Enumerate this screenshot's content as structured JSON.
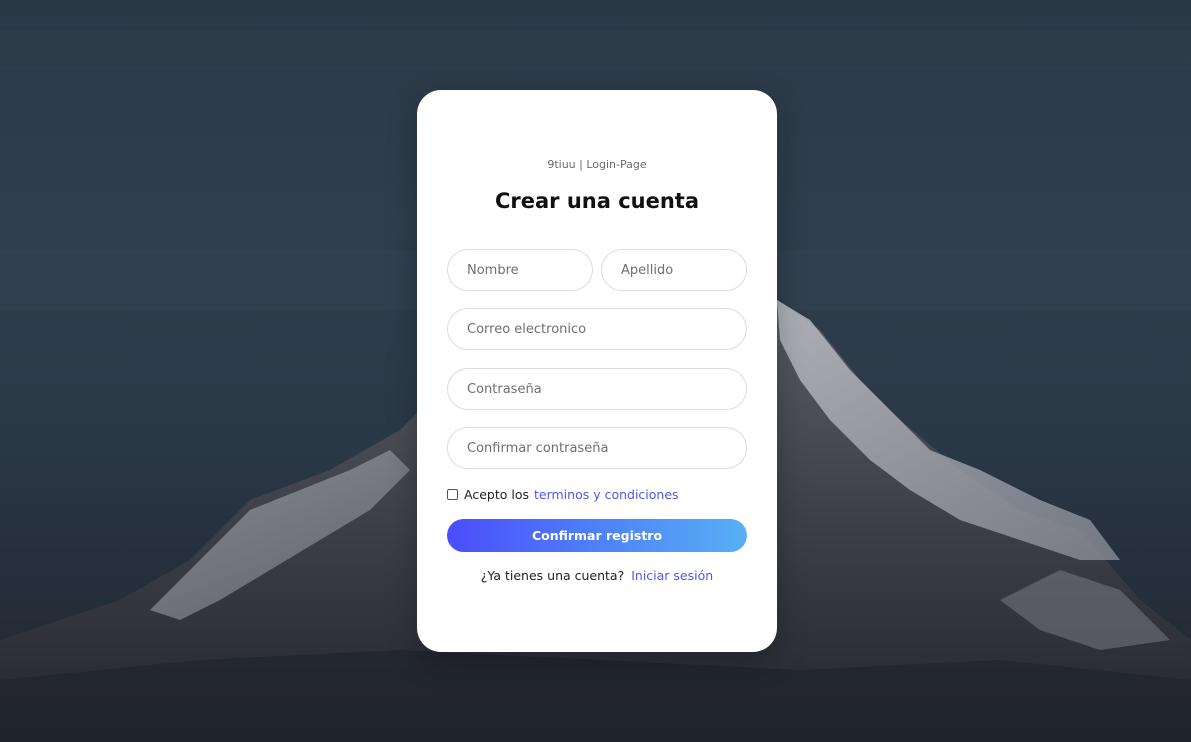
{
  "background": {
    "sky_color": "#2f3e4d",
    "mountain_color": "#4a4c55",
    "snow_color": "#b9bcc4"
  },
  "brand": {
    "text": "9tiuu | Login-Page"
  },
  "form": {
    "title": "Crear una cuenta",
    "fields": {
      "first_name": {
        "placeholder": "Nombre",
        "value": ""
      },
      "last_name": {
        "placeholder": "Apellido",
        "value": ""
      },
      "email": {
        "placeholder": "Correo electronico",
        "value": ""
      },
      "password": {
        "placeholder": "Contraseña",
        "value": ""
      },
      "confirm_password": {
        "placeholder": "Confirmar contraseña",
        "value": ""
      }
    },
    "terms": {
      "checked": false,
      "prefix": "Acepto los",
      "link_text": "terminos y condiciones"
    },
    "submit_label": "Confirmar registro",
    "signin": {
      "prompt": "¿Ya tienes una cuenta?",
      "link_text": "Iniciar sesión"
    }
  },
  "colors": {
    "accent": "#4d57e8",
    "button_gradient_start": "#4b4dfc",
    "button_gradient_end": "#58b0f6"
  }
}
